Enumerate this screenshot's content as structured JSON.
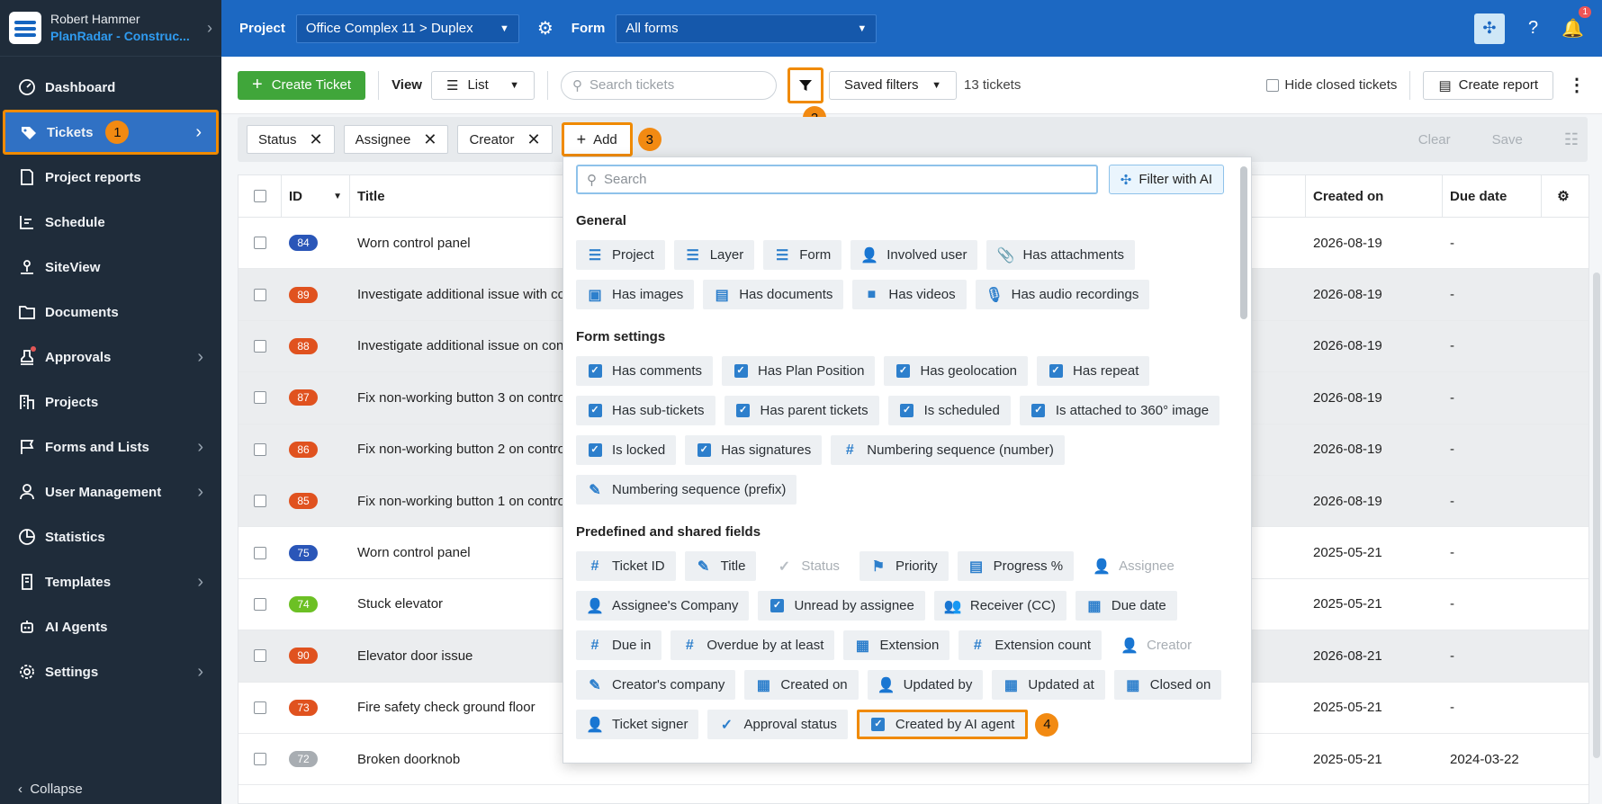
{
  "sidebar": {
    "user_name": "Robert Hammer",
    "company": "PlanRadar - Construc...",
    "items": [
      {
        "label": "Dashboard",
        "icon": "dashboard-icon",
        "arrow": false
      },
      {
        "label": "Tickets",
        "icon": "ticket-icon",
        "arrow": true,
        "active": true,
        "step": "1"
      },
      {
        "label": "Project reports",
        "icon": "report-icon",
        "arrow": false
      },
      {
        "label": "Schedule",
        "icon": "schedule-icon",
        "arrow": false
      },
      {
        "label": "SiteView",
        "icon": "siteview-icon",
        "arrow": false
      },
      {
        "label": "Documents",
        "icon": "folder-icon",
        "arrow": false
      },
      {
        "label": "Approvals",
        "icon": "stamp-icon",
        "arrow": true,
        "dot": true
      },
      {
        "label": "Projects",
        "icon": "building-icon",
        "arrow": false
      },
      {
        "label": "Forms and Lists",
        "icon": "flag-icon",
        "arrow": true
      },
      {
        "label": "User Management",
        "icon": "user-icon",
        "arrow": true
      },
      {
        "label": "Statistics",
        "icon": "pie-chart-icon",
        "arrow": false
      },
      {
        "label": "Templates",
        "icon": "template-icon",
        "arrow": true
      },
      {
        "label": "AI Agents",
        "icon": "robot-icon",
        "arrow": false
      },
      {
        "label": "Settings",
        "icon": "settings-icon",
        "arrow": true
      }
    ],
    "collapse_label": "Collapse"
  },
  "topbar": {
    "project_label": "Project",
    "project_value": "Office Complex 11 > Duplex",
    "form_label": "Form",
    "form_value": "All forms",
    "notification_count": "1"
  },
  "toolbar": {
    "create_ticket": "Create Ticket",
    "view_label": "View",
    "view_value": "List",
    "search_placeholder": "Search tickets",
    "filter_step": "2",
    "saved_filters": "Saved filters",
    "ticket_count": "13 tickets",
    "hide_closed": "Hide closed tickets",
    "create_report": "Create report"
  },
  "filterbar": {
    "chips": [
      "Status",
      "Assignee",
      "Creator"
    ],
    "add_label": "Add",
    "add_step": "3",
    "clear": "Clear",
    "save": "Save"
  },
  "table": {
    "headers": {
      "id": "ID",
      "title": "Title",
      "created": "Created on",
      "due": "Due date"
    },
    "rows": [
      {
        "id": "84",
        "color": "#2a56b8",
        "title": "Worn control panel",
        "created": "2026-08-19",
        "due": "-",
        "grey": false
      },
      {
        "id": "89",
        "color": "#e0521f",
        "title": "Investigate additional issue with co",
        "created": "2026-08-19",
        "due": "-",
        "grey": true
      },
      {
        "id": "88",
        "color": "#e0521f",
        "title": "Investigate additional issue on cont",
        "created": "2026-08-19",
        "due": "-",
        "grey": true
      },
      {
        "id": "87",
        "color": "#e0521f",
        "title": "Fix non-working button 3 on contro",
        "created": "2026-08-19",
        "due": "-",
        "grey": true
      },
      {
        "id": "86",
        "color": "#e0521f",
        "title": "Fix non-working button 2 on contro",
        "created": "2026-08-19",
        "due": "-",
        "grey": true
      },
      {
        "id": "85",
        "color": "#e0521f",
        "title": "Fix non-working button 1 on contro",
        "created": "2026-08-19",
        "due": "-",
        "grey": true
      },
      {
        "id": "75",
        "color": "#2a56b8",
        "title": "Worn control panel",
        "created": "2025-05-21",
        "due": "-",
        "grey": false
      },
      {
        "id": "74",
        "color": "#6cc024",
        "title": "Stuck elevator",
        "created": "2025-05-21",
        "due": "-",
        "grey": false
      },
      {
        "id": "90",
        "color": "#e0521f",
        "title": "Elevator door issue",
        "created": "2026-08-21",
        "due": "-",
        "grey": true
      },
      {
        "id": "73",
        "color": "#e0521f",
        "title": "Fire safety check ground floor",
        "created": "2025-05-21",
        "due": "-",
        "grey": false
      },
      {
        "id": "72",
        "color": "#a8adb2",
        "title": "Broken doorknob",
        "created": "2025-05-21",
        "due": "2024-03-22",
        "grey": false
      }
    ]
  },
  "panel": {
    "search_placeholder": "Search",
    "filter_ai": "Filter with AI",
    "sections": [
      {
        "title": "General",
        "options": [
          {
            "label": "Project",
            "icon": "list"
          },
          {
            "label": "Layer",
            "icon": "list"
          },
          {
            "label": "Form",
            "icon": "list"
          },
          {
            "label": "Involved user",
            "icon": "user"
          },
          {
            "label": "Has attachments",
            "icon": "clip"
          },
          {
            "label": "Has images",
            "icon": "image"
          },
          {
            "label": "Has documents",
            "icon": "doc"
          },
          {
            "label": "Has videos",
            "icon": "video"
          },
          {
            "label": "Has audio recordings",
            "icon": "mic"
          }
        ]
      },
      {
        "title": "Form settings",
        "options": [
          {
            "label": "Has comments",
            "icon": "check"
          },
          {
            "label": "Has Plan Position",
            "icon": "check"
          },
          {
            "label": "Has geolocation",
            "icon": "check"
          },
          {
            "label": "Has repeat",
            "icon": "check"
          },
          {
            "label": "Has sub-tickets",
            "icon": "check"
          },
          {
            "label": "Has parent tickets",
            "icon": "check"
          },
          {
            "label": "Is scheduled",
            "icon": "check"
          },
          {
            "label": "Is attached to 360° image",
            "icon": "check"
          },
          {
            "label": "Is locked",
            "icon": "check"
          },
          {
            "label": "Has signatures",
            "icon": "check"
          },
          {
            "label": "Numbering sequence (number)",
            "icon": "hash"
          },
          {
            "label": "Numbering sequence (prefix)",
            "icon": "edit"
          }
        ]
      },
      {
        "title": "Predefined and shared fields",
        "options": [
          {
            "label": "Ticket ID",
            "icon": "hash"
          },
          {
            "label": "Title",
            "icon": "edit"
          },
          {
            "label": "Status",
            "icon": "tick",
            "disabled": true
          },
          {
            "label": "Priority",
            "icon": "priority"
          },
          {
            "label": "Progress %",
            "icon": "progress"
          },
          {
            "label": "Assignee",
            "icon": "user",
            "disabled": true
          },
          {
            "label": "Assignee's Company",
            "icon": "user"
          },
          {
            "label": "Unread by assignee",
            "icon": "check"
          },
          {
            "label": "Receiver (CC)",
            "icon": "users"
          },
          {
            "label": "Due date",
            "icon": "calendar"
          },
          {
            "label": "Due in",
            "icon": "hash"
          },
          {
            "label": "Overdue by at least",
            "icon": "hash"
          },
          {
            "label": "Extension",
            "icon": "calendar"
          },
          {
            "label": "Extension count",
            "icon": "hash"
          },
          {
            "label": "Creator",
            "icon": "user",
            "disabled": true
          },
          {
            "label": "Creator's company",
            "icon": "edit"
          },
          {
            "label": "Created on",
            "icon": "calendar"
          },
          {
            "label": "Updated by",
            "icon": "user"
          },
          {
            "label": "Updated at",
            "icon": "calendar"
          },
          {
            "label": "Closed on",
            "icon": "calendar"
          },
          {
            "label": "Ticket signer",
            "icon": "user"
          },
          {
            "label": "Approval status",
            "icon": "tick"
          },
          {
            "label": "Created by AI agent",
            "icon": "check",
            "highlight": true,
            "step": "4"
          }
        ]
      }
    ]
  }
}
